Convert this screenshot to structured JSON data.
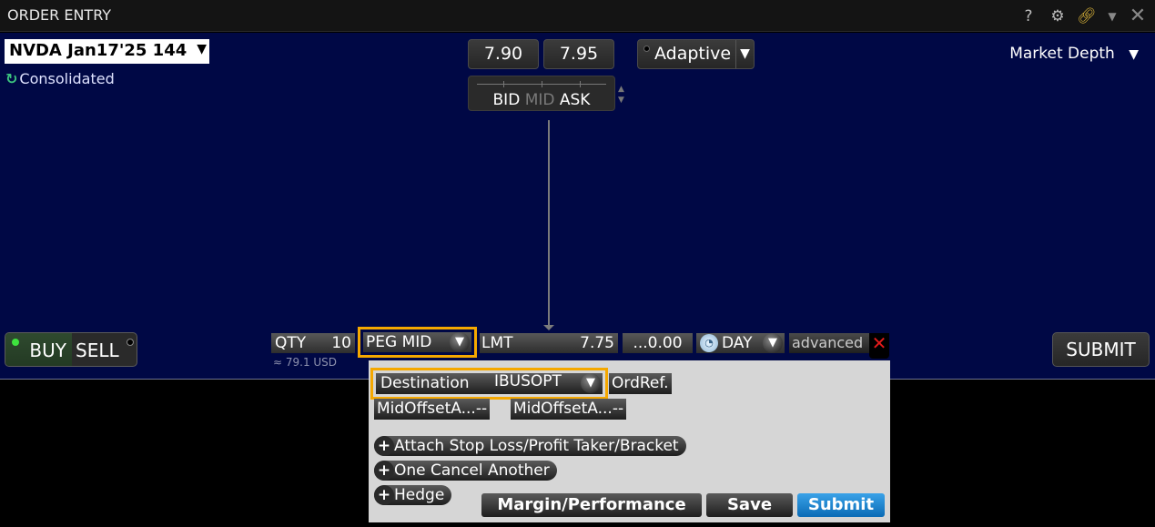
{
  "window": {
    "title": "ORDER ENTRY",
    "icons": [
      "help-icon",
      "gear-icon",
      "link-icon",
      "caret-down-icon",
      "close-icon"
    ]
  },
  "instrument": {
    "symbol": "NVDA Jan17'25 144",
    "feed": "Consolidated"
  },
  "quote": {
    "bid_price": "7.90",
    "ask_price": "7.95",
    "labels": {
      "bid": "BID",
      "mid": "MID",
      "ask": "ASK"
    }
  },
  "algo": {
    "selected": "Adaptive"
  },
  "market_depth_label": "Market Depth",
  "side": {
    "buy": "BUY",
    "sell": "SELL",
    "selected": "BUY"
  },
  "order": {
    "qty_label": "QTY",
    "qty_value": "10",
    "notional": "≈ 79.1 USD",
    "order_type": "PEG MID",
    "limit_label": "LMT",
    "limit_price": "7.75",
    "offset": "...0.00",
    "tif": "DAY",
    "advanced_label": "advanced",
    "submit_label": "SUBMIT"
  },
  "advanced_panel": {
    "destination_label": "Destination",
    "destination_value": "IBUSOPT",
    "ordref_label": "OrdRef.",
    "mid_offset_fields": [
      {
        "label": "MidOffsetA...",
        "value": "--"
      },
      {
        "label": "MidOffsetA...",
        "value": "--"
      }
    ],
    "attachments": [
      "Attach Stop Loss/Profit Taker/Bracket",
      "One Cancel Another",
      "Hedge"
    ],
    "buttons": {
      "margin": "Margin/Performance",
      "save": "Save",
      "submit": "Submit"
    }
  },
  "colors": {
    "panel_bg": "#000845",
    "highlight": "#f5a800",
    "submit_blue": "#1a86d0",
    "buy_dot": "#3ee33e",
    "close_x": "#e21b1b"
  }
}
